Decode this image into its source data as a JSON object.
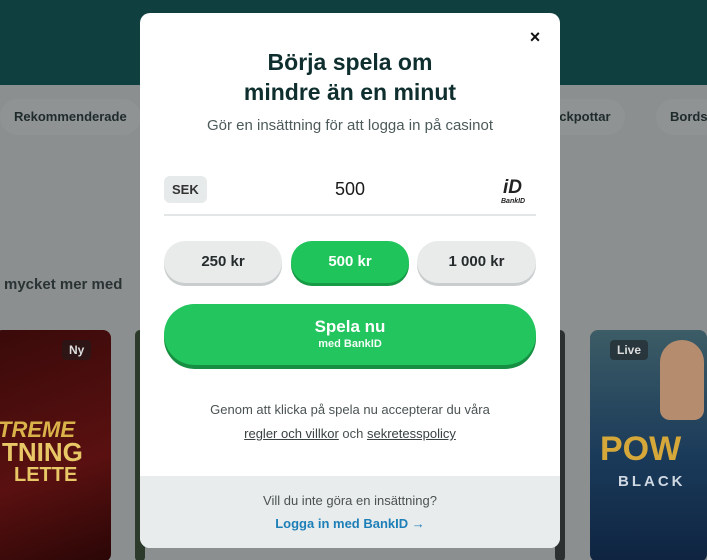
{
  "background": {
    "chips": [
      "Rekommenderade",
      "ackpottar",
      "Bords"
    ],
    "more_text": "mycket mer med",
    "tiles": {
      "new_badge": "Ny",
      "live_badge": "Live",
      "tile1_text1": "TREME",
      "tile1_text2": "TNING",
      "tile1_text3": "LETTE",
      "tile4_text1": "POW",
      "tile4_text2": "BLACK"
    }
  },
  "modal": {
    "close_label": "×",
    "title_line1": "Börja spela om",
    "title_line2": "mindre än en minut",
    "subtitle": "Gör en insättning för att logga in på casinot",
    "currency": "SEK",
    "amount": "500",
    "bankid_text": "BankID",
    "presets": [
      "250 kr",
      "500 kr",
      "1 000 kr"
    ],
    "selected_preset": "500 kr",
    "play_button_label": "Spela nu",
    "play_button_sub": "med BankID",
    "terms_pre": "Genom att klicka på spela nu accepterar du våra",
    "terms_link1": "regler och villkor",
    "terms_mid": " och ",
    "terms_link2": "sekretesspolicy",
    "footer_question": "Vill du inte göra en insättning?",
    "footer_link": "Logga in med BankID →"
  },
  "colors": {
    "accent_green": "#22c55e",
    "header_teal": "#0f3f3f",
    "link_blue": "#1d7fb8"
  }
}
